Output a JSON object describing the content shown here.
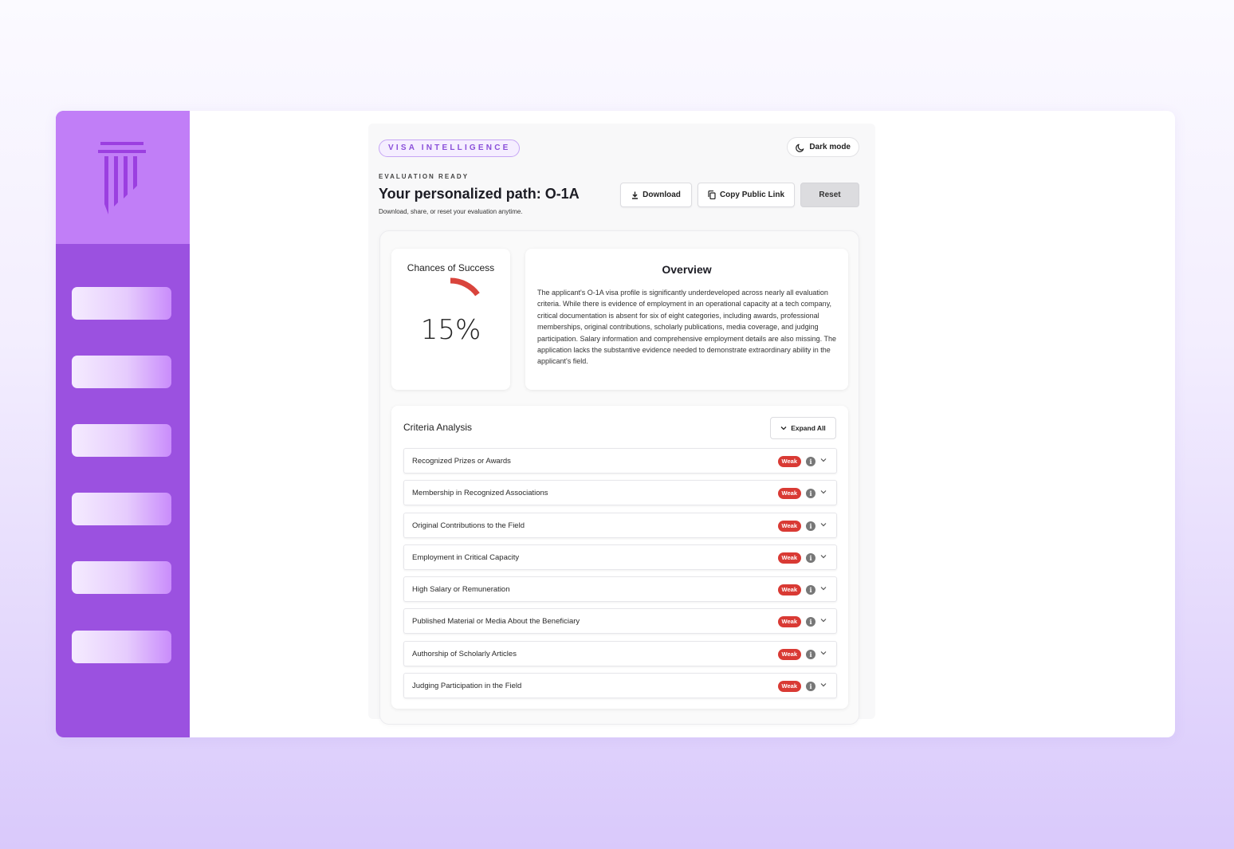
{
  "header": {
    "badge": "VISA INTELLIGENCE",
    "dark_mode_label": "Dark mode",
    "eyebrow": "EVALUATION READY",
    "title": "Your personalized path: O-1A",
    "subtitle": "Download, share, or reset your evaluation anytime."
  },
  "actions": {
    "download": "Download",
    "copy_link": "Copy Public Link",
    "reset": "Reset"
  },
  "chance": {
    "label": "Chances of Success",
    "value_text": "15%",
    "value": 15,
    "color": "#d9443c"
  },
  "overview": {
    "title": "Overview",
    "text": "The applicant's O-1A visa profile is significantly underdeveloped across nearly all evaluation criteria. While there is evidence of employment in an operational capacity at a tech company, critical documentation is absent for six of eight categories, including awards, professional memberships, original contributions, scholarly publications, media coverage, and judging participation. Salary information and comprehensive employment details are also missing. The application lacks the substantive evidence needed to demonstrate extraordinary ability in the applicant's field."
  },
  "criteria": {
    "title": "Criteria Analysis",
    "expand_label": "Expand All",
    "items": [
      {
        "label": "Recognized Prizes or Awards",
        "status": "Weak"
      },
      {
        "label": "Membership in Recognized Associations",
        "status": "Weak"
      },
      {
        "label": "Original Contributions to the Field",
        "status": "Weak"
      },
      {
        "label": "Employment in Critical Capacity",
        "status": "Weak"
      },
      {
        "label": "High Salary or Remuneration",
        "status": "Weak"
      },
      {
        "label": "Published Material or Media About the Beneficiary",
        "status": "Weak"
      },
      {
        "label": "Authorship of Scholarly Articles",
        "status": "Weak"
      },
      {
        "label": "Judging Participation in the Field",
        "status": "Weak"
      }
    ]
  },
  "icons": {
    "logo": "pillar-logo-icon",
    "moon": "moon-icon",
    "download": "download-icon",
    "copy": "copy-icon",
    "chevron": "chevron-down-icon",
    "info": "info-icon"
  },
  "colors": {
    "sidebar": "#9b51e0",
    "sidebar_top": "#c17ef7",
    "accent": "#8a4fd9",
    "weak": "#d93a34"
  }
}
